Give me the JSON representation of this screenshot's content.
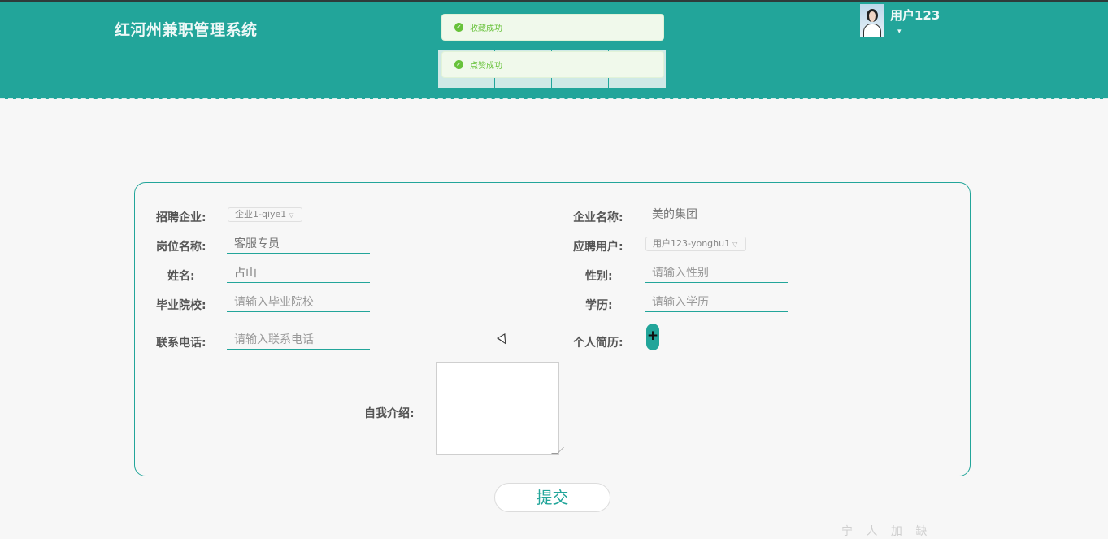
{
  "header": {
    "app_title": "红河州兼职管理系统",
    "user_name": "用户123",
    "user_caret": "▾"
  },
  "toasts": [
    {
      "text": "收藏成功",
      "icon": "check-circle-icon"
    },
    {
      "text": "点赞成功",
      "icon": "check-circle-icon"
    }
  ],
  "colors": {
    "accent": "#22a59a",
    "success": "#67c23a",
    "background": "#f7f7f7"
  },
  "form": {
    "company_label": "招聘企业:",
    "company_value": "企业1-qiye1",
    "company_name_label": "企业名称:",
    "company_name_value": "美的集团",
    "position_label": "岗位名称:",
    "position_value": "客服专员",
    "applicant_label": "应聘用户:",
    "applicant_value": "用户123-yonghu1",
    "name_label": "姓名:",
    "name_value": "占山",
    "gender_label": "性别:",
    "gender_placeholder": "请输入性别",
    "school_label": "毕业院校:",
    "school_placeholder": "请输入毕业院校",
    "education_label": "学历:",
    "education_placeholder": "请输入学历",
    "phone_label": "联系电话:",
    "phone_placeholder": "请输入联系电话",
    "resume_label": "个人简历:",
    "resume_upload_icon": "plus-icon",
    "intro_label": "自我介绍:",
    "intro_value": ""
  },
  "actions": {
    "submit_label": "提交"
  },
  "footer": {
    "faint_text": "宁 人 加 缺"
  }
}
